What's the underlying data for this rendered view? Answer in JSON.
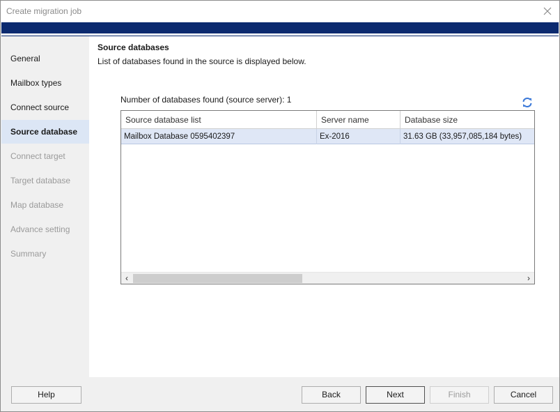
{
  "window": {
    "title": "Create migration job"
  },
  "sidebar": {
    "items": [
      {
        "label": "General",
        "state": "normal"
      },
      {
        "label": "Mailbox types",
        "state": "normal"
      },
      {
        "label": "Connect source",
        "state": "normal"
      },
      {
        "label": "Source database",
        "state": "active"
      },
      {
        "label": "Connect target",
        "state": "disabled"
      },
      {
        "label": "Target database",
        "state": "disabled"
      },
      {
        "label": "Map database",
        "state": "disabled"
      },
      {
        "label": "Advance setting",
        "state": "disabled"
      },
      {
        "label": "Summary",
        "state": "disabled"
      }
    ]
  },
  "main": {
    "title": "Source databases",
    "description": "List of databases found in the source is displayed below.",
    "count_text": "Number of databases found (source server): 1",
    "refresh_icon": "refresh-icon",
    "table": {
      "columns": [
        "Source database list",
        "Server name",
        "Database size"
      ],
      "rows": [
        [
          "Mailbox Database 0595402397",
          "Ex-2016",
          "31.63 GB (33,957,085,184 bytes)"
        ]
      ]
    }
  },
  "footer": {
    "help": "Help",
    "back": "Back",
    "next": "Next",
    "finish": "Finish",
    "cancel": "Cancel"
  },
  "colors": {
    "banner": "#0b2a6f",
    "active_nav": "#dce6f5",
    "selected_row": "#dfe7f6",
    "refresh": "#3a78d8"
  }
}
